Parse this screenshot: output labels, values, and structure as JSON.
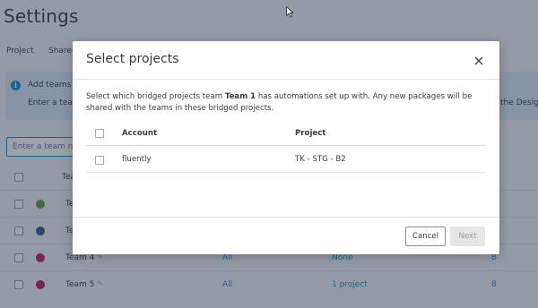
{
  "page": {
    "title": "Settings",
    "tabs": [
      "Project",
      "Shared"
    ],
    "info": {
      "title": "Add teams to",
      "subtitle": "Enter a team",
      "right_text": "the Design"
    },
    "search_placeholder": "Enter a team nam",
    "team_table": {
      "header": "Team",
      "rows": [
        {
          "name": "Te",
          "color": "#5aa63a",
          "all": "",
          "project": "",
          "count": ""
        },
        {
          "name": "Te",
          "color": "#3d5a88",
          "all": "",
          "project": "",
          "count": ""
        },
        {
          "name": "Team 4",
          "color": "#c2185b",
          "all": "All",
          "project": "None",
          "count": "8"
        },
        {
          "name": "Team 5",
          "color": "#c2185b",
          "all": "All",
          "project": "1 project",
          "count": "8"
        }
      ]
    }
  },
  "modal": {
    "title": "Select projects",
    "description": {
      "before": "Select which bridged projects team ",
      "team": "Team 1",
      "after": " has automations set up with. Any new packages will be shared with the teams in these bridged projects."
    },
    "columns": {
      "account": "Account",
      "project": "Project"
    },
    "rows": [
      {
        "account": "fluently",
        "project": "TK - STG - B2"
      }
    ],
    "buttons": {
      "cancel": "Cancel",
      "next": "Next"
    }
  },
  "icons": {
    "close": "close-icon",
    "info": "info-icon",
    "cursor": "mouse-cursor-icon",
    "edit": "pencil-icon"
  },
  "colors": {
    "accent": "#0696d7",
    "overlay": "rgba(30,44,70,0.45)"
  }
}
